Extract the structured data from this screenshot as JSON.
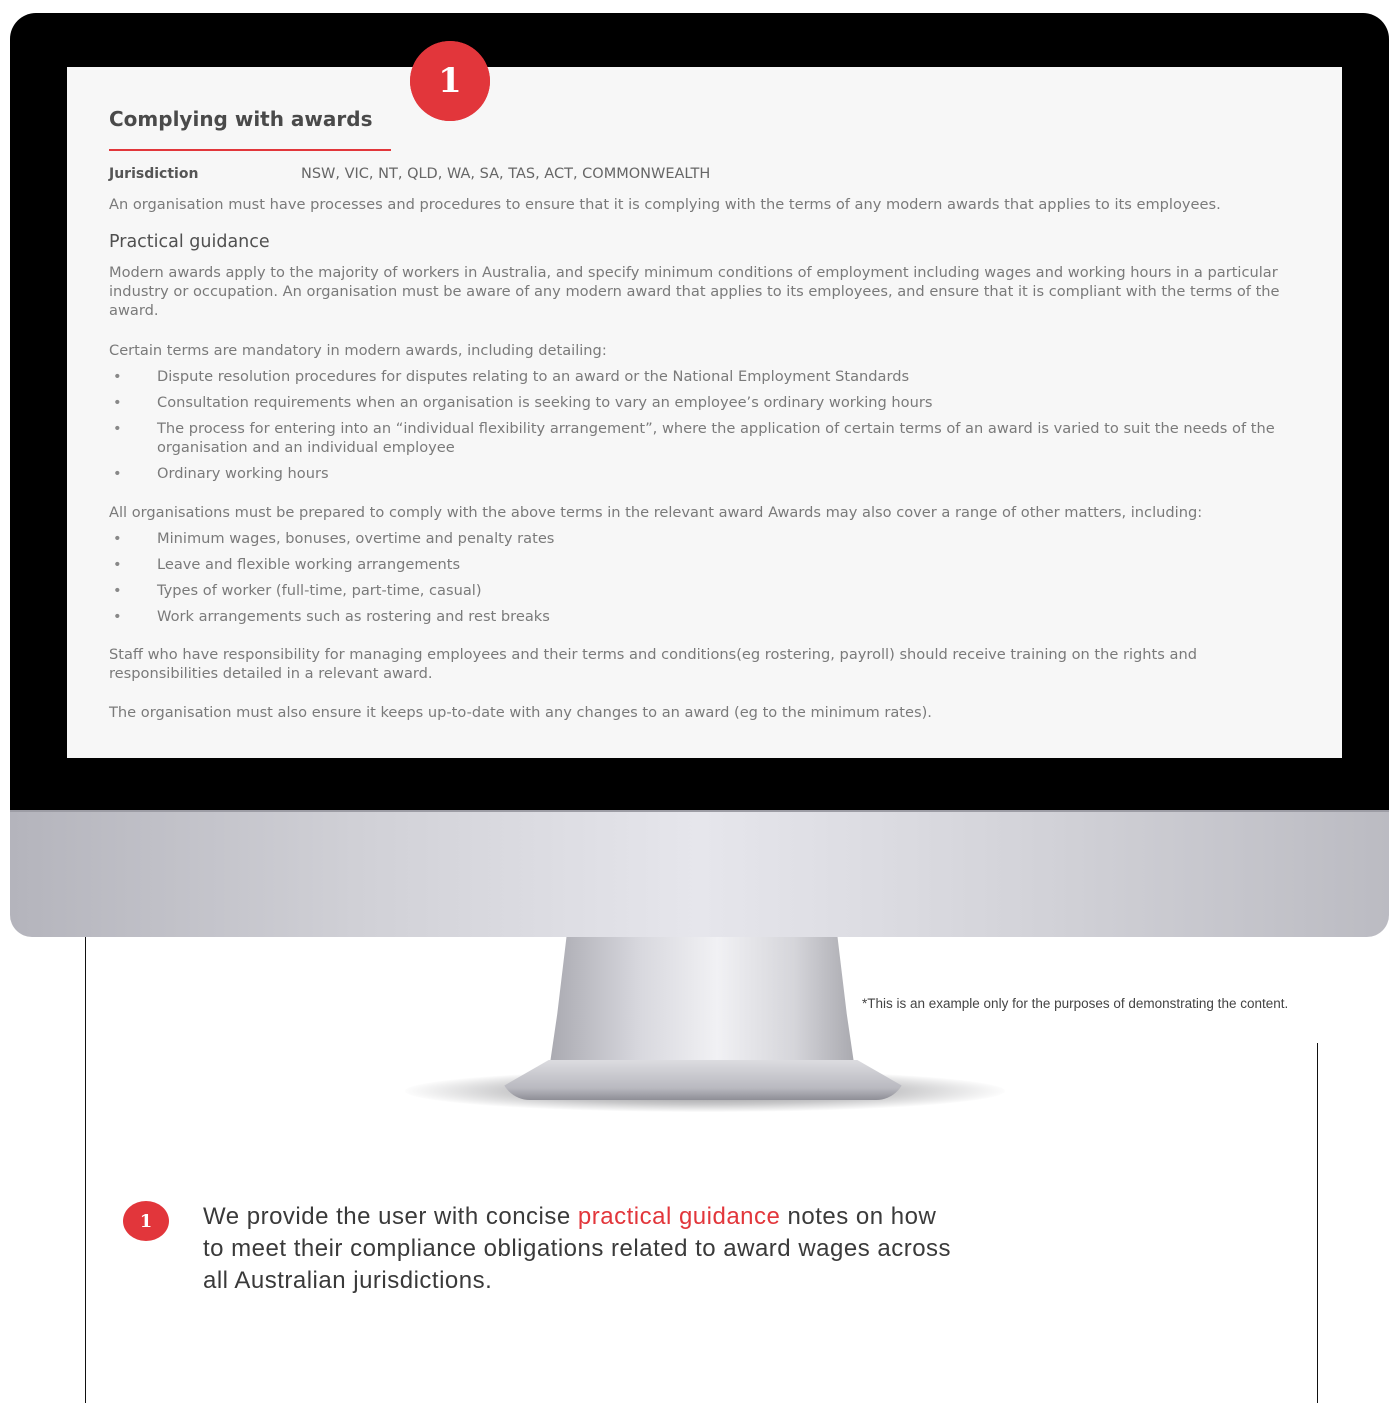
{
  "accent_color": "#e2363b",
  "screen": {
    "badge_number": "1",
    "title": "Complying with awards",
    "jurisdiction_label": "Jurisdiction",
    "jurisdiction_value": "NSW, VIC, NT, QLD, WA, SA, TAS, ACT, COMMONWEALTH",
    "intro": "An organisation must have processes and procedures to ensure that it is complying  with the terms of any modern awards that applies to its employees.",
    "practical_heading": "Practical guidance",
    "para1": "Modern awards apply to the majority of workers in Australia, and specify minimum conditions of employment including wages and working hours in a particular industry or occupation. An organisation must be aware of any modern award that applies to its employees, and ensure that it is compliant with the terms of the award.",
    "para2": "Certain terms are mandatory in modern awards, including detailing:",
    "list1": [
      "Dispute resolution procedures for disputes relating to an award or the National Employment Standards",
      "Consultation requirements when an organisation is seeking to vary an employee’s ordinary working hours",
      "The process for entering into an “individual flexibility arrangement”, where the application of certain terms of an award is varied to suit the needs of the organisation and an individual employee",
      "Ordinary working hours"
    ],
    "para3": "All organisations must be prepared to comply with the above terms in the relevant award Awards may also cover a range of other matters, including:",
    "list2": [
      "Minimum wages, bonuses, overtime and penalty rates",
      "Leave and flexible working arrangements",
      "Types of worker (full-time, part-time, casual)",
      "Work arrangements such as rostering and rest breaks"
    ],
    "para4": "Staff who have responsibility for managing employees and their terms and conditions(eg rostering, payroll) should receive training on the rights and responsibilities detailed in a relevant award.",
    "para5": "The organisation must also ensure it keeps up-to-date with any changes to an award (eg to the minimum rates)."
  },
  "disclaimer": "*This is an example only for the purposes of demonstrating the content.",
  "note": {
    "badge_number": "1",
    "text_before": "We provide the user with concise ",
    "highlight": "practical guidance",
    "text_after": " notes on how to meet their compliance obligations related to award wages across all Australian jurisdictions."
  }
}
